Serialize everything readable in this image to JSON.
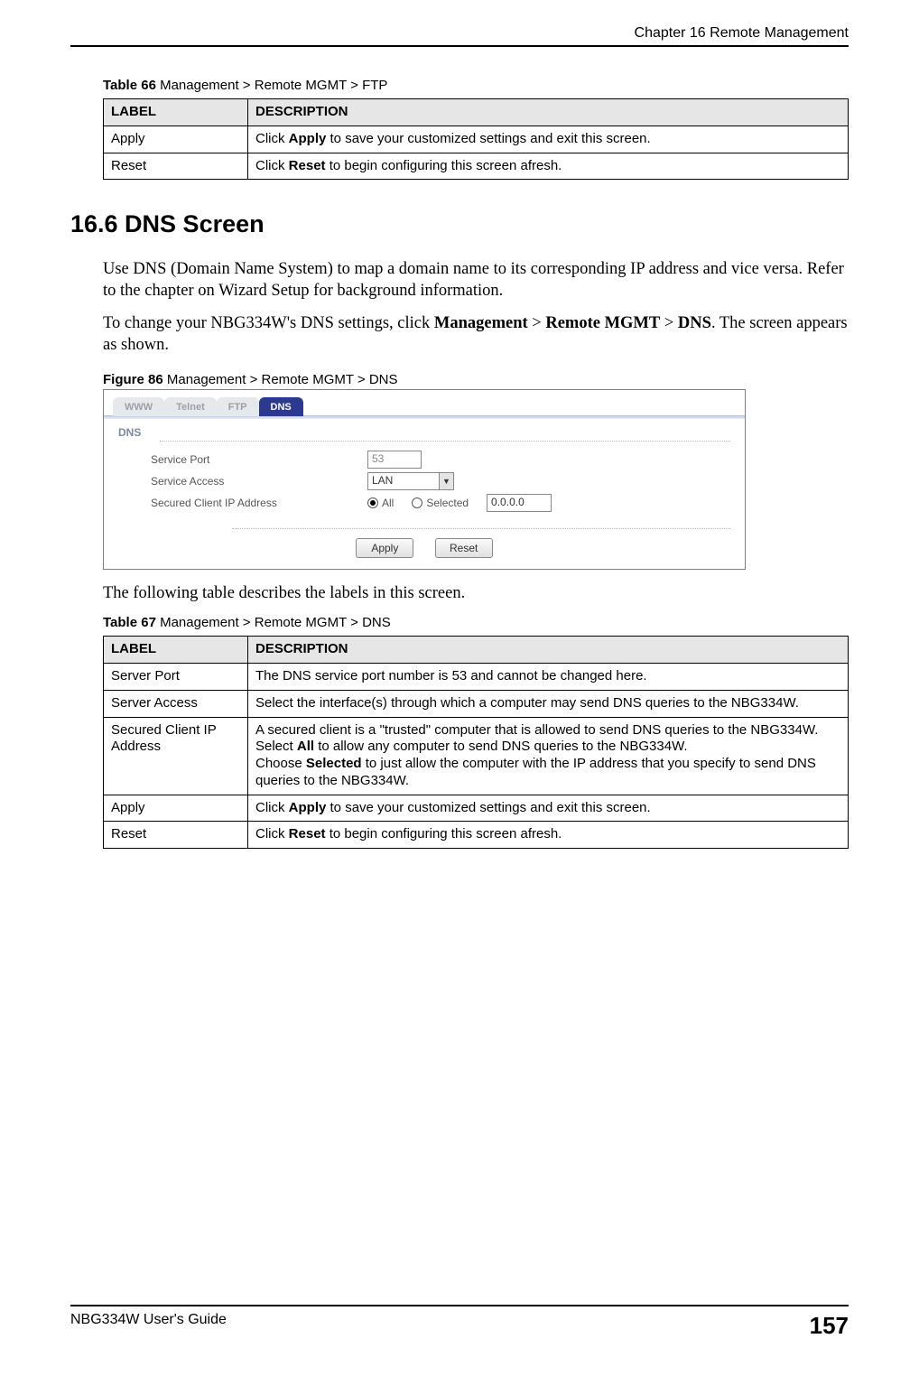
{
  "chapter_header": "Chapter 16 Remote Management",
  "table66": {
    "caption_bold": "Table 66",
    "caption_rest": "   Management > Remote MGMT > FTP",
    "headers": {
      "c1": "LABEL",
      "c2": "DESCRIPTION"
    },
    "rows": [
      {
        "label": "Apply",
        "desc_pre": "Click ",
        "desc_bold": "Apply",
        "desc_post": " to save your customized settings and exit this screen."
      },
      {
        "label": "Reset",
        "desc_pre": "Click ",
        "desc_bold": "Reset",
        "desc_post": " to begin configuring this screen afresh."
      }
    ]
  },
  "section_heading": "16.6  DNS Screen",
  "para1": "Use DNS (Domain Name System) to map a domain name to its corresponding IP address and vice versa. Refer to the chapter on Wizard Setup for background information.",
  "para2": {
    "pre": "To change your NBG334W's DNS settings, click ",
    "bold1": "Management",
    "sep1": " > ",
    "bold2": "Remote MGMT",
    "sep2": " > ",
    "bold3": "DNS",
    "post": ". The screen appears as shown."
  },
  "figure_caption": {
    "bold": "Figure 86",
    "rest": "   Management > Remote MGMT > DNS"
  },
  "screenshot": {
    "tabs": {
      "www": "WWW",
      "telnet": "Telnet",
      "ftp": "FTP",
      "dns": "DNS"
    },
    "panel_title": "DNS",
    "labels": {
      "service_port": "Service Port",
      "service_access": "Service Access",
      "secured_ip": "Secured Client IP Address"
    },
    "values": {
      "service_port": "53",
      "service_access": "LAN",
      "ip": "0.0.0.0"
    },
    "radio": {
      "all": "All",
      "selected": "Selected"
    },
    "buttons": {
      "apply": "Apply",
      "reset": "Reset"
    }
  },
  "para3": "The following table describes the labels in this screen.",
  "table67": {
    "caption_bold": "Table 67",
    "caption_rest": "   Management > Remote MGMT > DNS",
    "headers": {
      "c1": "LABEL",
      "c2": "DESCRIPTION"
    },
    "rows": {
      "r0": {
        "label": "Server Port",
        "desc": "The DNS service port number is 53 and cannot be changed here."
      },
      "r1": {
        "label": "Server Access",
        "desc": "Select the interface(s) through which a computer may send DNS queries to the NBG334W."
      },
      "r2": {
        "label": "Secured Client IP Address",
        "line1": "A secured client is a \"trusted\" computer that is allowed to send DNS queries to the NBG334W.",
        "line2_pre": "Select ",
        "line2_bold": "All",
        "line2_post": " to allow any computer to send DNS queries to the NBG334W.",
        "line3_pre": "Choose ",
        "line3_bold": "Selected",
        "line3_post": " to just allow the computer with the IP address that you specify to send DNS queries to the NBG334W."
      },
      "r3": {
        "label": "Apply",
        "desc_pre": "Click ",
        "desc_bold": "Apply",
        "desc_post": " to save your customized settings and exit this screen."
      },
      "r4": {
        "label": "Reset",
        "desc_pre": "Click ",
        "desc_bold": "Reset",
        "desc_post": " to begin configuring this screen afresh."
      }
    }
  },
  "footer": {
    "guide": "NBG334W User's Guide",
    "page": "157"
  }
}
